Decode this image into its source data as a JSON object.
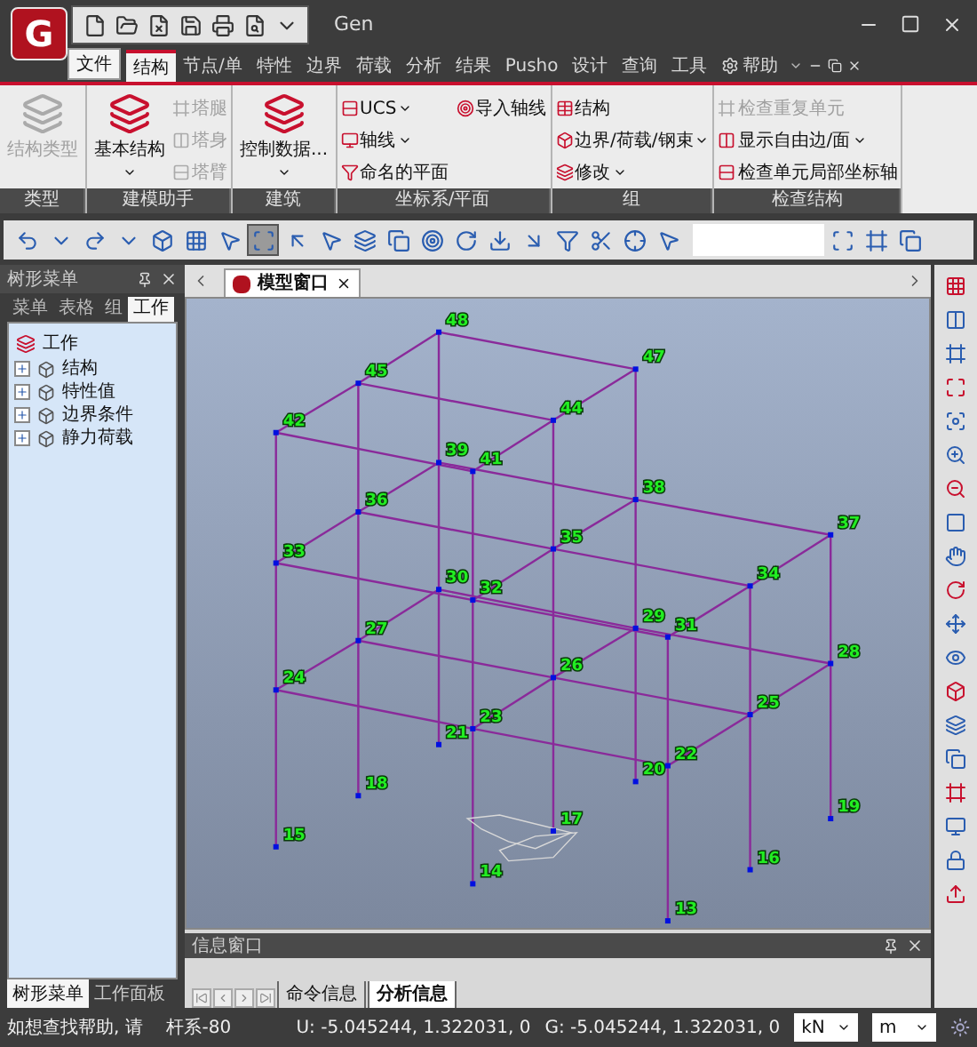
{
  "app": {
    "logo": "G",
    "title": "Gen"
  },
  "file_button": {
    "label": "文件"
  },
  "tabs": [
    {
      "label": "结构",
      "selected": true
    },
    {
      "label": "节点/单",
      "selected": false
    },
    {
      "label": "特性",
      "selected": false
    },
    {
      "label": "边界",
      "selected": false
    },
    {
      "label": "荷载",
      "selected": false
    },
    {
      "label": "分析",
      "selected": false
    },
    {
      "label": "结果",
      "selected": false
    },
    {
      "label": "Pusho",
      "selected": false
    },
    {
      "label": "设计",
      "selected": false
    },
    {
      "label": "查询",
      "selected": false
    },
    {
      "label": "工具",
      "selected": false
    }
  ],
  "help_tab": {
    "label": "帮助"
  },
  "ribbon": {
    "groups": [
      {
        "label": "类型",
        "items": [
          {
            "kind": "large",
            "label": "结构类型",
            "disabled": true,
            "dropdown": false
          }
        ]
      },
      {
        "label": "建模助手",
        "items": [
          {
            "kind": "large",
            "label": "基本结构",
            "disabled": false,
            "dropdown": true
          },
          {
            "kind": "small",
            "label": "塔腿",
            "disabled": true,
            "dropdown": false
          },
          {
            "kind": "small",
            "label": "塔身",
            "disabled": true,
            "dropdown": false
          },
          {
            "kind": "small",
            "label": "塔臂",
            "disabled": true,
            "dropdown": false
          }
        ]
      },
      {
        "label": "建筑",
        "items": [
          {
            "kind": "large",
            "label": "控制数据...",
            "disabled": false,
            "dropdown": true
          }
        ]
      },
      {
        "label": "坐标系/平面",
        "items": [
          {
            "kind": "small",
            "label": "UCS",
            "disabled": false,
            "dropdown": true
          },
          {
            "kind": "small",
            "label": "轴线",
            "disabled": false,
            "dropdown": true
          },
          {
            "kind": "small",
            "label": "命名的平面",
            "disabled": false,
            "dropdown": false
          },
          {
            "kind": "small",
            "label": "导入轴线",
            "disabled": false,
            "dropdown": false
          }
        ]
      },
      {
        "label": "组",
        "items": [
          {
            "kind": "small",
            "label": "结构",
            "disabled": false,
            "dropdown": false
          },
          {
            "kind": "small",
            "label": "边界/荷载/钢束",
            "disabled": false,
            "dropdown": true
          },
          {
            "kind": "small",
            "label": "修改",
            "disabled": false,
            "dropdown": true
          }
        ]
      },
      {
        "label": "检查结构",
        "items": [
          {
            "kind": "small",
            "label": "检查重复单元",
            "disabled": true,
            "dropdown": false
          },
          {
            "kind": "small",
            "label": "显示自由边/面",
            "disabled": false,
            "dropdown": true
          },
          {
            "kind": "small",
            "label": "检查单元局部坐标轴",
            "disabled": false,
            "dropdown": false
          }
        ]
      }
    ]
  },
  "left_panel": {
    "title": "树形菜单",
    "tabs": [
      {
        "label": "菜单",
        "selected": false
      },
      {
        "label": "表格",
        "selected": false
      },
      {
        "label": "组",
        "selected": false
      },
      {
        "label": "工作",
        "selected": true
      }
    ],
    "tree": [
      {
        "label": "工作",
        "children": [
          {
            "label": "结构",
            "expanded": false
          },
          {
            "label": "特性值",
            "expanded": false
          },
          {
            "label": "边界条件",
            "expanded": false
          },
          {
            "label": "静力荷载",
            "expanded": false
          }
        ]
      }
    ],
    "bottom_tabs": [
      {
        "label": "树形菜单",
        "selected": true
      },
      {
        "label": "工作面板",
        "selected": false
      }
    ]
  },
  "document_tab": {
    "label": "模型窗口"
  },
  "model": {
    "nodes": [
      "13",
      "14",
      "15",
      "16",
      "17",
      "18",
      "19",
      "20",
      "21",
      "22",
      "23",
      "24",
      "25",
      "26",
      "27",
      "28",
      "29",
      "30",
      "31",
      "32",
      "33",
      "34",
      "35",
      "36",
      "37",
      "38",
      "39",
      "41",
      "42",
      "44",
      "45",
      "47",
      "48"
    ]
  },
  "info_window": {
    "title": "信息窗口",
    "tabs": [
      {
        "label": "命令信息",
        "selected": false
      },
      {
        "label": "分析信息",
        "selected": true
      }
    ]
  },
  "status_bar": {
    "hint": "如想查找帮助, 请",
    "element": "杆系-80",
    "ucs": "U: -5.045244, 1.322031, 0",
    "global": "G: -5.045244, 1.322031, 0",
    "force_unit": "kN",
    "length_unit": "m"
  }
}
